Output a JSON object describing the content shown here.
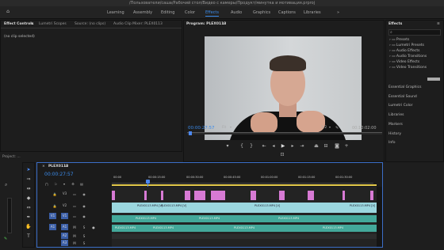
{
  "window": {
    "title": "/Пользователи/саша/Рабочий стол/Видео с камеры/Продукт/минутка и мотивация.prproj"
  },
  "workspaces": {
    "home_icon": "home-icon",
    "items": [
      "Learning",
      "Assembly",
      "Editing",
      "Color",
      "Effects",
      "Audio",
      "Graphics",
      "Captions",
      "Libraries"
    ],
    "active": "Effects",
    "more": "»"
  },
  "left_panel": {
    "tabs": [
      "Effect Controls",
      "Lumetri Scopes",
      "Source: (no clips)",
      "Audio Clip Mixer: PLEX0113"
    ],
    "menu_icon": "≡",
    "no_clip": "(no clip selected)"
  },
  "program": {
    "title": "Program: PLEX0113",
    "menu_icon": "≡",
    "timecode": "00:00:27:57",
    "fit": "Fit",
    "quality": "1/2",
    "duration": "00:10:02:00",
    "wrench_icon": "wrench-icon"
  },
  "effects_panel": {
    "title": "Effects",
    "menu_icon": "≡",
    "search_icon": "search-icon",
    "folders": [
      "Presets",
      "Lumetri Presets",
      "Audio Effects",
      "Audio Transitions",
      "Video Effects",
      "Video Transitions"
    ],
    "sections": [
      "Essential Graphics",
      "Essential Sound",
      "Lumetri Color",
      "Libraries",
      "Markers",
      "History",
      "Info"
    ]
  },
  "project": {
    "title": "Project: ..."
  },
  "timeline": {
    "title": "PLEX0113",
    "menu_icon": "≡",
    "close": "×",
    "timecode": "00:00:27:57",
    "ruler": [
      "00:00",
      "00:00:15:00",
      "00:00:30:00",
      "00:00:45:00",
      "00:01:00:00",
      "00:01:15:00",
      "00:01:30:00"
    ],
    "video_tracks": [
      "V3",
      "V2",
      "V1"
    ],
    "audio_tracks": [
      "A1",
      "A2",
      "A3"
    ],
    "clip_label": "PLEX0113.MP4 [V]",
    "audio_label": "PLEX0113.MP4"
  },
  "colors": {
    "accent": "#3b8bea",
    "video_clip": "#9bd7df",
    "graphic_clip": "#d77ad4",
    "audio_clip": "#43a89a",
    "playhead": "#4c88f0"
  }
}
